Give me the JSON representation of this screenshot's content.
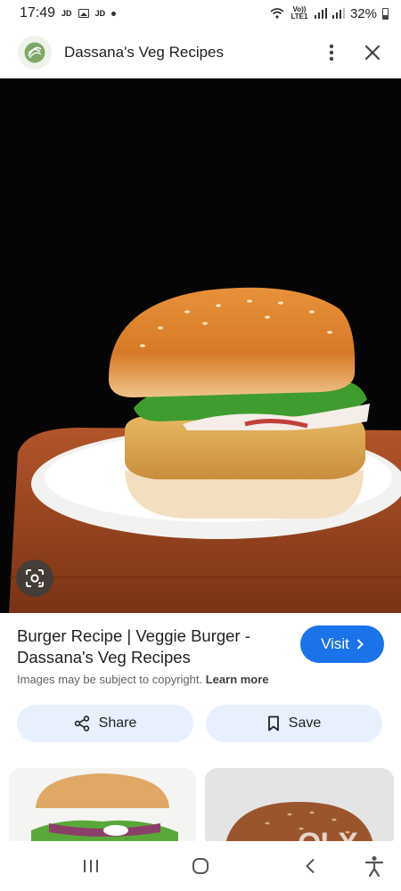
{
  "status_bar": {
    "time": "17:49",
    "left_tags": [
      "JD",
      "JD"
    ],
    "volte": "Vo)) LTE1",
    "battery": "32%"
  },
  "header": {
    "site_name": "Dassana's Veg Recipes",
    "menu_icon": "more-vert-icon",
    "close_icon": "close-icon"
  },
  "result": {
    "title": "Burger Recipe | Veggie Burger - Dassana's Veg Recipes",
    "visit_label": "Visit",
    "copyright_text": "Images may be subject to copyright.",
    "learn_more": "Learn more"
  },
  "actions": {
    "share_label": "Share",
    "save_label": "Save"
  },
  "watermark": "OLX",
  "colors": {
    "accent": "#1a73e8",
    "chip_bg": "#e8f0fe",
    "hero_bg": "#050505"
  }
}
